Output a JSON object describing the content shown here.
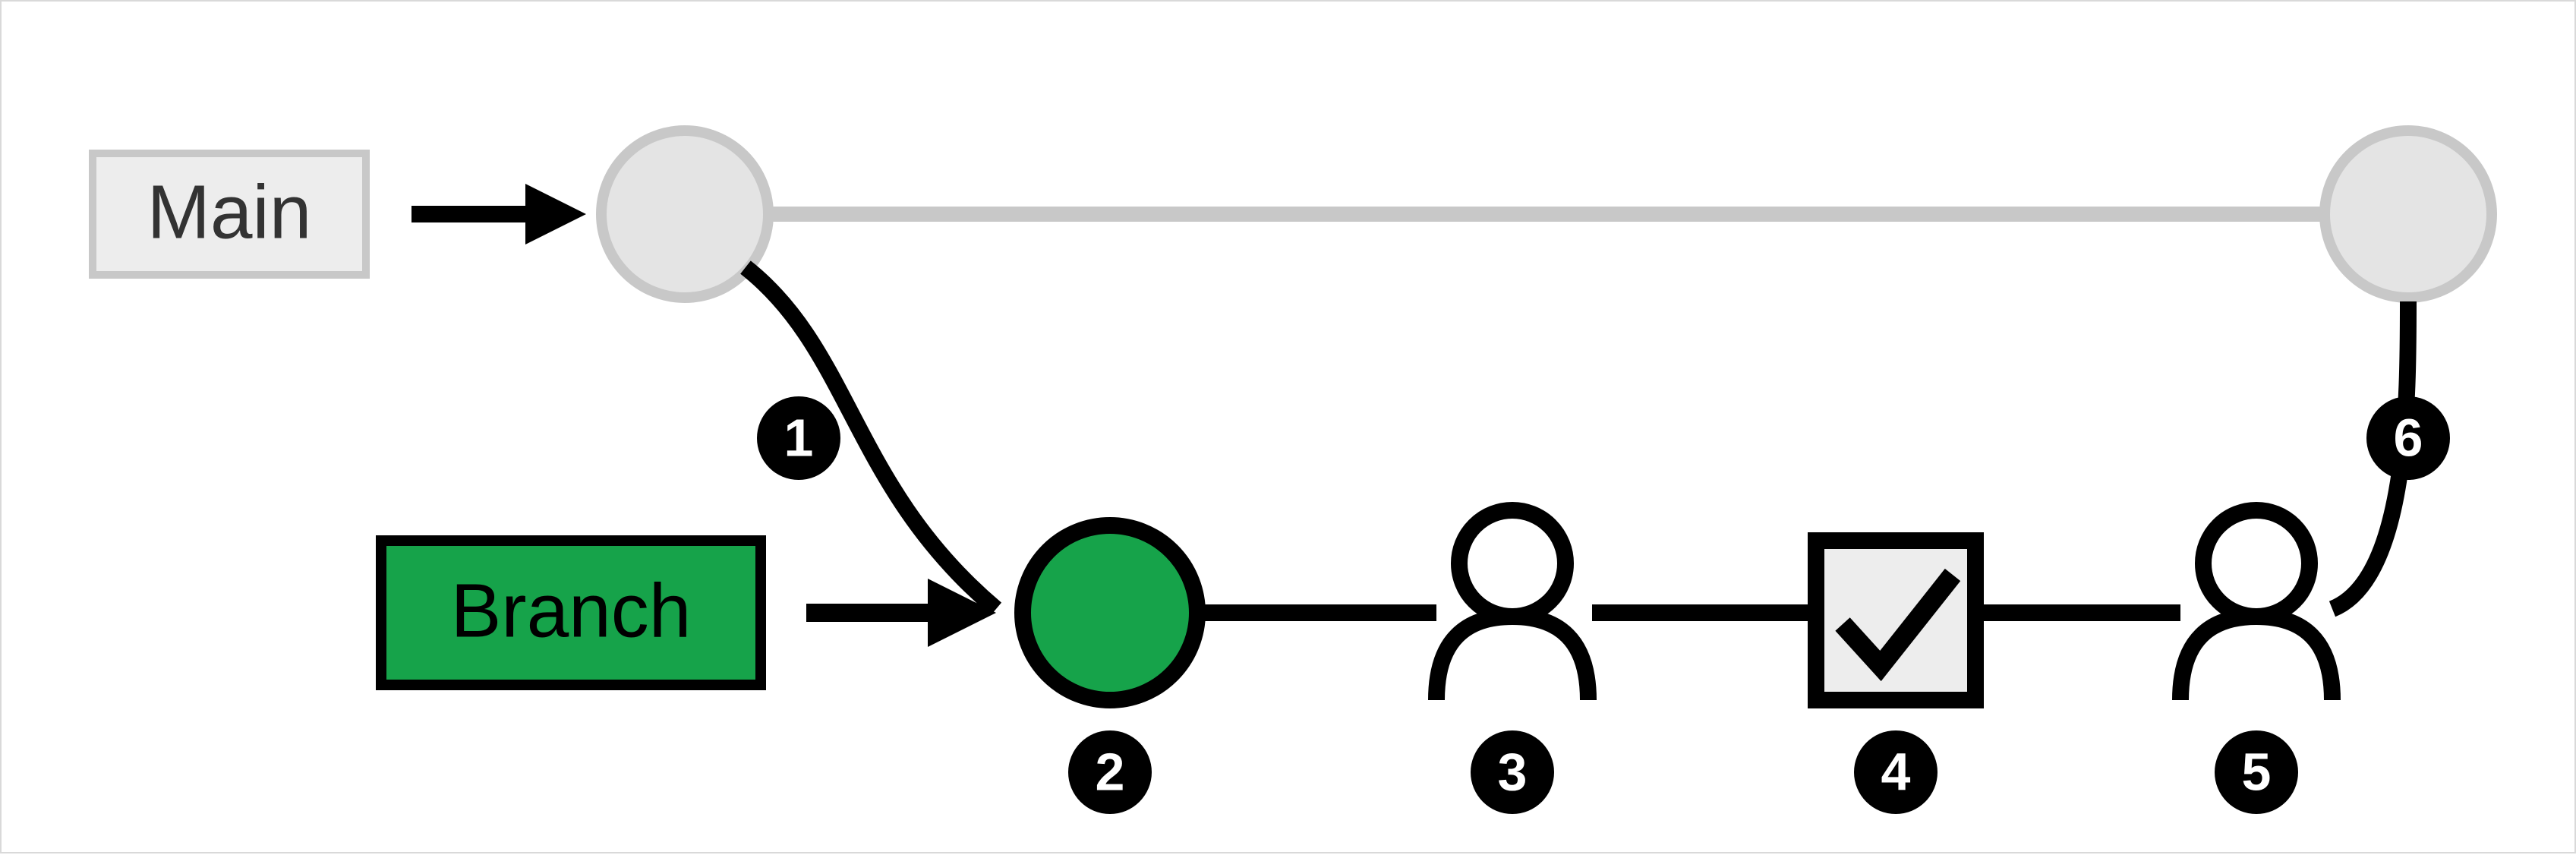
{
  "labels": {
    "main": "Main",
    "branch": "Branch"
  },
  "steps": {
    "s1": "1",
    "s2": "2",
    "s3": "3",
    "s4": "4",
    "s5": "5",
    "s6": "6"
  },
  "colors": {
    "muted": "#e4e4e4",
    "mutedStroke": "#c8c8c8",
    "green": "#16a34a",
    "black": "#000000",
    "greyFill": "#ededed"
  }
}
